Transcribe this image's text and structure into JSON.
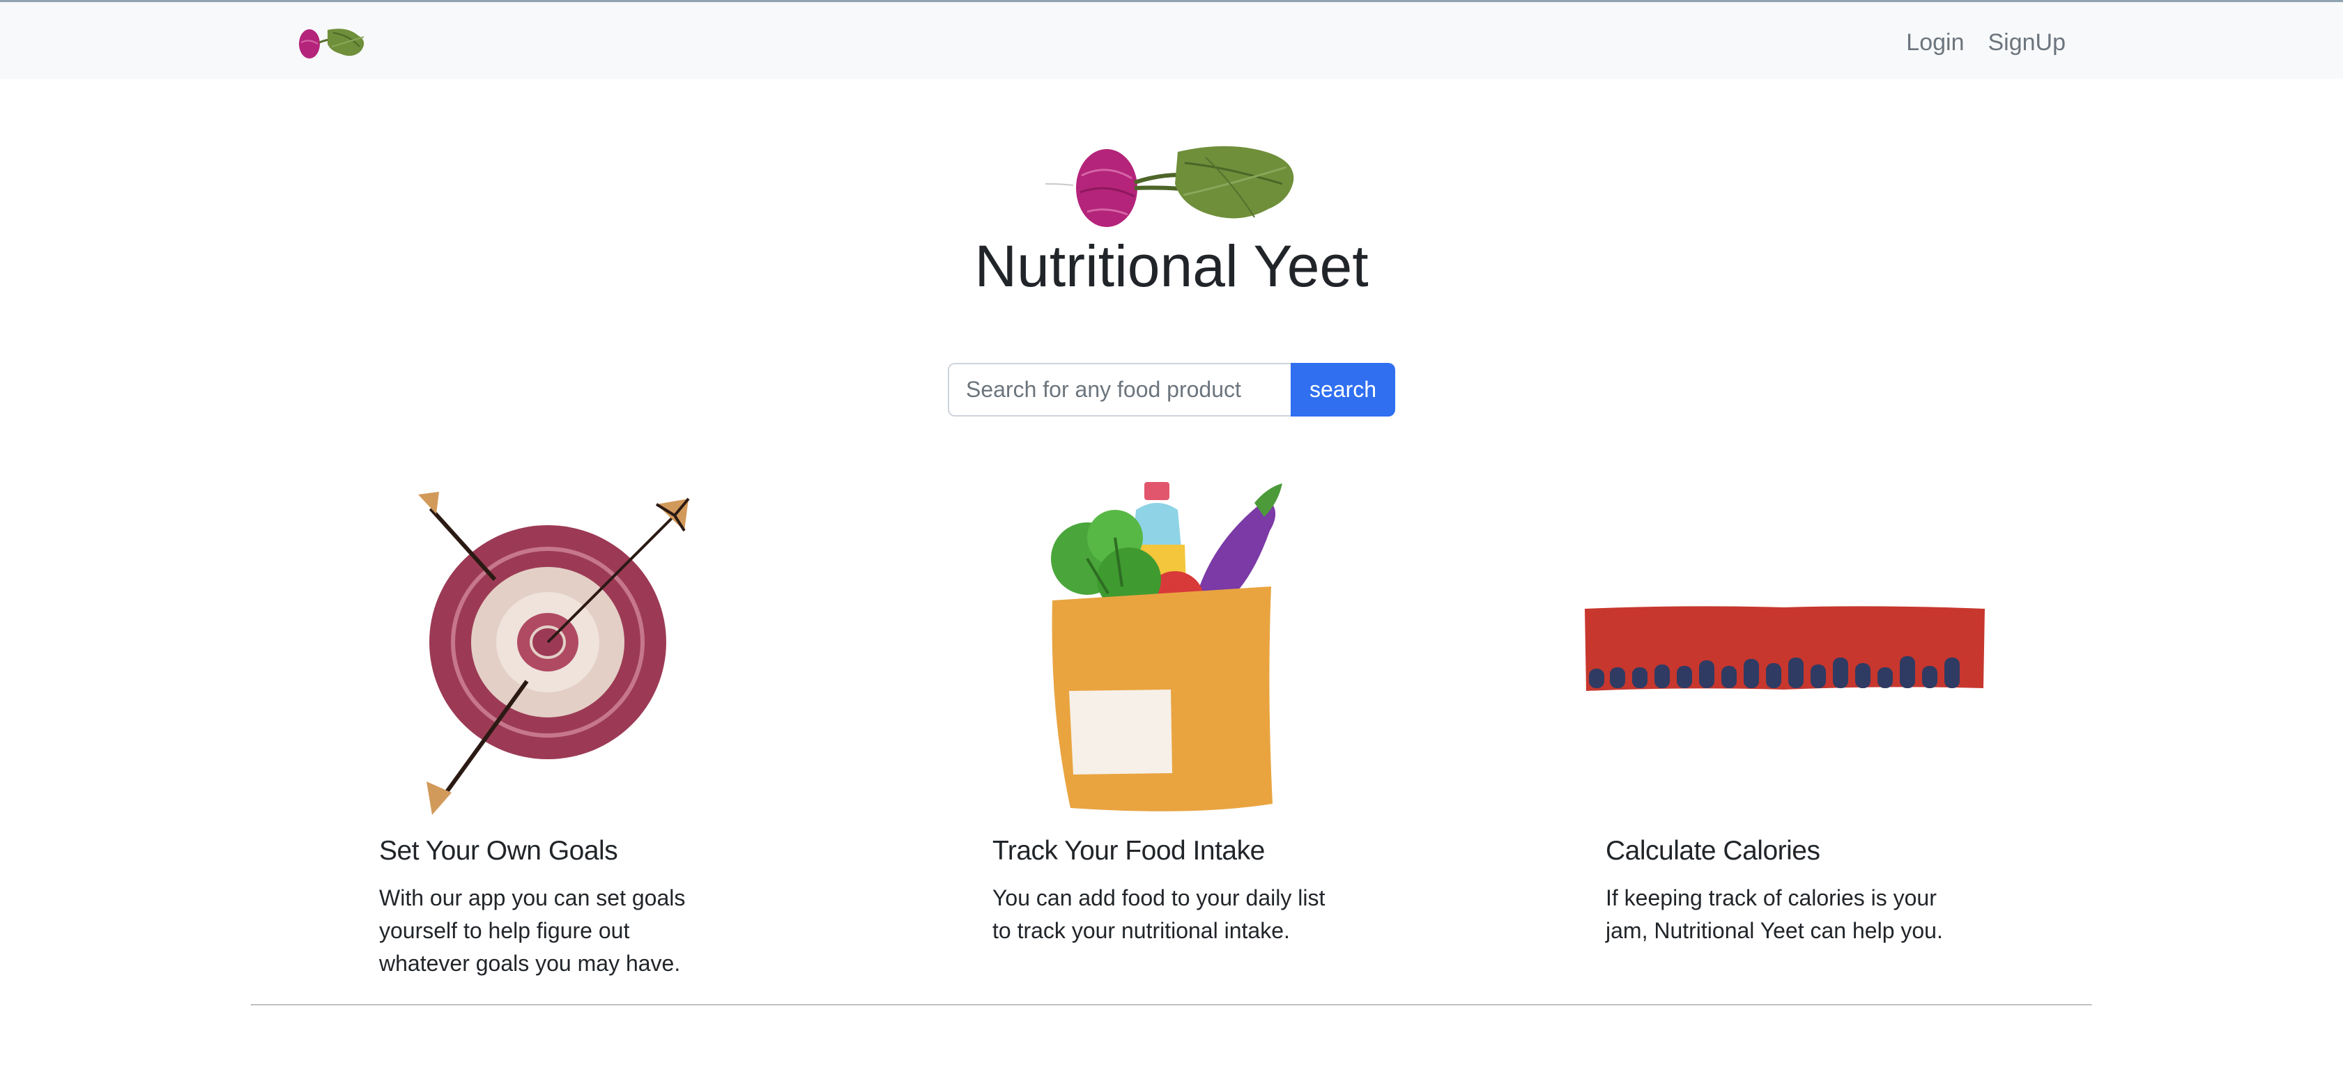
{
  "navbar": {
    "logo_icon": "beet-icon",
    "links": [
      {
        "label": "Login"
      },
      {
        "label": "SignUp"
      }
    ]
  },
  "hero": {
    "logo_icon": "beet-icon",
    "title": "Nutritional Yeet"
  },
  "search": {
    "placeholder": "Search for any food product",
    "value": "",
    "button_label": "search"
  },
  "features": [
    {
      "icon": "target-with-arrows-icon",
      "title": "Set Your Own Goals",
      "lines": [
        "With our app you can set goals",
        "yourself to help figure out",
        "whatever goals you may have."
      ]
    },
    {
      "icon": "grocery-bag-icon",
      "title": "Track Your Food Intake",
      "lines": [
        "You can add food to your daily list",
        "to track your nutritional intake."
      ]
    },
    {
      "icon": "calorie-strip-icon",
      "title": "Calculate Calories",
      "lines": [
        "If keeping track of calories is your",
        "jam, Nutritional Yeet can help you."
      ]
    }
  ],
  "colors": {
    "navbar_bg": "#f8f9fa",
    "accent": "#2f6ff0",
    "beet": "#b4247a",
    "leaf": "#6f8f3a",
    "target": "#9c3a55",
    "strip_red": "#c7372e",
    "strip_blue": "#2f3b63"
  }
}
